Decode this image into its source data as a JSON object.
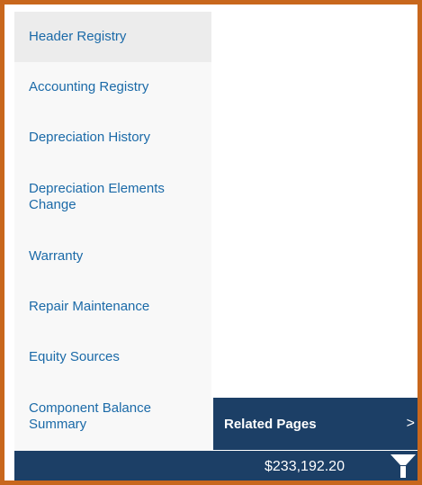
{
  "menu": {
    "items": [
      {
        "label": "Header Registry"
      },
      {
        "label": "Accounting Registry"
      },
      {
        "label": "Depreciation History"
      },
      {
        "label": "Depreciation Elements Change"
      },
      {
        "label": "Warranty"
      },
      {
        "label": "Repair Maintenance"
      },
      {
        "label": "Equity Sources"
      },
      {
        "label": "Component Balance Summary"
      }
    ]
  },
  "related": {
    "label": "Related Pages",
    "chevron": ">"
  },
  "footer": {
    "total": "$233,192.20",
    "filter_icon": "funnel-icon"
  },
  "colors": {
    "border": "#c8671d",
    "link": "#1b6aa8",
    "bar": "#1c3f66",
    "menu_bg": "#f8f8f8",
    "active_bg": "#ececec"
  }
}
